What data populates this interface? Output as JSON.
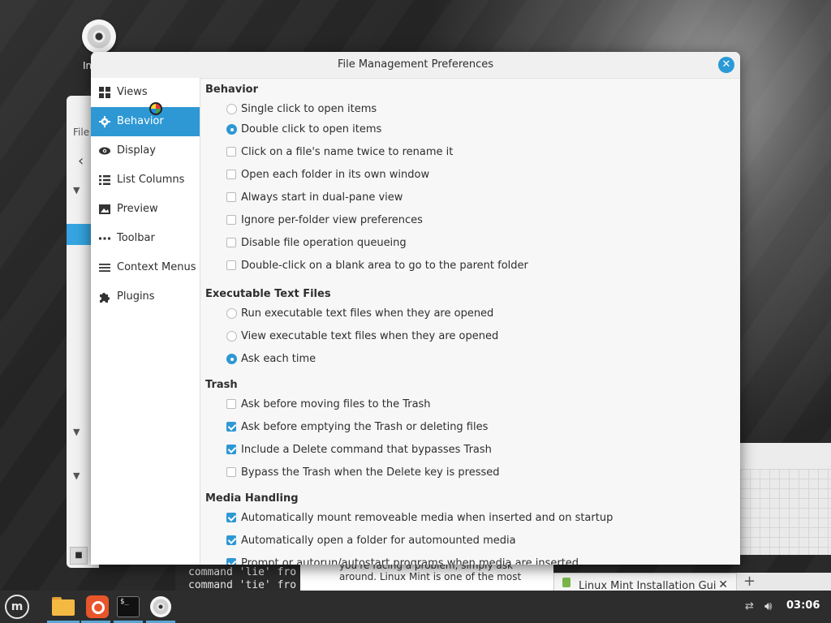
{
  "desktop": {
    "icon_label": "In"
  },
  "background_windows": {
    "nemo_title_fragment": "File",
    "terminal_lines": [
      "command 'lie' fro",
      "command 'tie' fro"
    ],
    "doc_lines": [
      "you're facing a problem, simply ask",
      "around. Linux Mint is one of the most"
    ],
    "browser_tab_label": "Linux Mint Installation Gui",
    "browser_new_tab": "+"
  },
  "dialog": {
    "title": "File Management Preferences",
    "close_label": "✕",
    "sidebar": [
      {
        "label": "Views",
        "icon": "grid-icon",
        "active": false
      },
      {
        "label": "Behavior",
        "icon": "gear-icon",
        "active": true
      },
      {
        "label": "Display",
        "icon": "eye-icon",
        "active": false
      },
      {
        "label": "List Columns",
        "icon": "list-icon",
        "active": false
      },
      {
        "label": "Preview",
        "icon": "image-icon",
        "active": false
      },
      {
        "label": "Toolbar",
        "icon": "dots-icon",
        "active": false
      },
      {
        "label": "Context Menus",
        "icon": "menu-icon",
        "active": false
      },
      {
        "label": "Plugins",
        "icon": "puzzle-icon",
        "active": false
      }
    ],
    "sections": {
      "behavior": {
        "title": "Behavior",
        "radios": [
          {
            "label": "Single click to open items",
            "selected": false
          },
          {
            "label": "Double click to open items",
            "selected": true
          }
        ],
        "checks": [
          {
            "label": "Click on a file's name twice to rename it",
            "checked": false
          },
          {
            "label": "Open each folder in its own window",
            "checked": false
          },
          {
            "label": "Always start in dual-pane view",
            "checked": false
          },
          {
            "label": "Ignore per-folder view preferences",
            "checked": false
          },
          {
            "label": "Disable file operation queueing",
            "checked": false
          },
          {
            "label": "Double-click on a blank area to go to the parent folder",
            "checked": false
          }
        ]
      },
      "executable": {
        "title": "Executable Text Files",
        "radios": [
          {
            "label": "Run executable text files when they are opened",
            "selected": false
          },
          {
            "label": "View executable text files when they are opened",
            "selected": false
          },
          {
            "label": "Ask each time",
            "selected": true
          }
        ]
      },
      "trash": {
        "title": "Trash",
        "checks": [
          {
            "label": "Ask before moving files to the Trash",
            "checked": false
          },
          {
            "label": "Ask before emptying the Trash or deleting files",
            "checked": true
          },
          {
            "label": "Include a Delete command that bypasses Trash",
            "checked": true
          },
          {
            "label": "Bypass the Trash when the Delete key is pressed",
            "checked": false
          }
        ]
      },
      "media": {
        "title": "Media Handling",
        "checks": [
          {
            "label": "Automatically mount removeable media when inserted and on startup",
            "checked": true
          },
          {
            "label": "Automatically open a folder for automounted media",
            "checked": true
          },
          {
            "label": "Prompt or autorun/autostart programs when media are inserted",
            "checked": true
          }
        ]
      }
    }
  },
  "taskbar": {
    "menu_label": "m",
    "terminal_prompt": "$_",
    "clock": "03:06",
    "accent": "#5aa7d6"
  }
}
